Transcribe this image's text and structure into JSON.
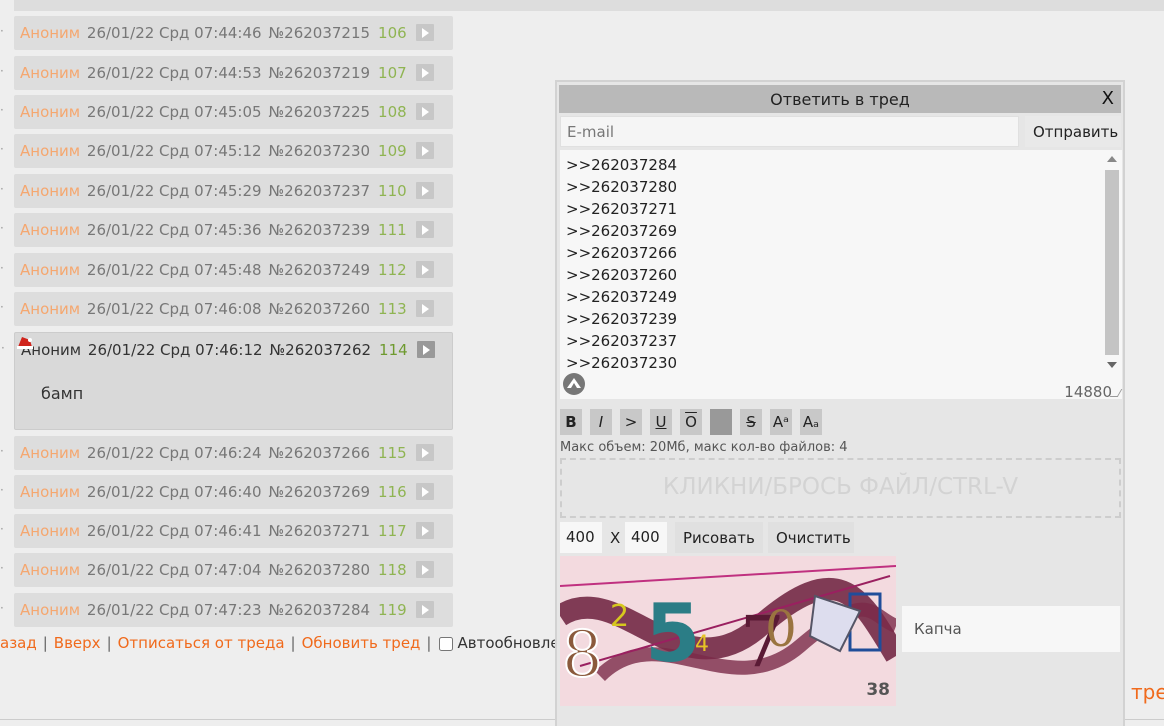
{
  "posts": [
    {
      "name": "Аноним",
      "date": "26/01/22 Срд 07:44:46",
      "num": "№262037215",
      "count": "106"
    },
    {
      "name": "Аноним",
      "date": "26/01/22 Срд 07:44:53",
      "num": "№262037219",
      "count": "107"
    },
    {
      "name": "Аноним",
      "date": "26/01/22 Срд 07:45:05",
      "num": "№262037225",
      "count": "108"
    },
    {
      "name": "Аноним",
      "date": "26/01/22 Срд 07:45:12",
      "num": "№262037230",
      "count": "109"
    },
    {
      "name": "Аноним",
      "date": "26/01/22 Срд 07:45:29",
      "num": "№262037237",
      "count": "110"
    },
    {
      "name": "Аноним",
      "date": "26/01/22 Срд 07:45:36",
      "num": "№262037239",
      "count": "111"
    },
    {
      "name": "Аноним",
      "date": "26/01/22 Срд 07:45:48",
      "num": "№262037249",
      "count": "112"
    },
    {
      "name": "Аноним",
      "date": "26/01/22 Срд 07:46:08",
      "num": "№262037260",
      "count": "113"
    },
    {
      "name": "Аноним",
      "date": "26/01/22 Срд 07:46:12",
      "num": "№262037262",
      "count": "114",
      "body": "бамп"
    },
    {
      "name": "Аноним",
      "date": "26/01/22 Срд 07:46:24",
      "num": "№262037266",
      "count": "115"
    },
    {
      "name": "Аноним",
      "date": "26/01/22 Срд 07:46:40",
      "num": "№262037269",
      "count": "116"
    },
    {
      "name": "Аноним",
      "date": "26/01/22 Срд 07:46:41",
      "num": "№262037271",
      "count": "117"
    },
    {
      "name": "Аноним",
      "date": "26/01/22 Срд 07:47:04",
      "num": "№262037280",
      "count": "118"
    },
    {
      "name": "Аноним",
      "date": "26/01/22 Срд 07:47:23",
      "num": "№262037284",
      "count": "119"
    }
  ],
  "nav": {
    "back": "азад",
    "up": "Вверх",
    "unsubscribe": "Отписаться от треда",
    "refresh": "Обновить тред",
    "autoupdate": "Автообновле",
    "sep": "|",
    "tail": "тре"
  },
  "reply": {
    "title": "Ответить в тред",
    "close": "X",
    "email_placeholder": "E-mail",
    "send": "Отправить",
    "text_lines": [
      ">>262037284",
      ">>262037280",
      ">>262037271",
      ">>262037269",
      ">>262037266",
      ">>262037260",
      ">>262037249",
      ">>262037239",
      ">>262037237",
      ">>262037230"
    ],
    "char_count": "14880",
    "format_buttons": [
      "B",
      "I",
      ">",
      "U",
      "O",
      "",
      "S",
      "Aᵃ",
      "Aₐ"
    ],
    "limit": "Макс объем: 20Мб, макс кол-во файлов: 4",
    "dropzone": "КЛИКНИ/БРОСЬ ФАЙЛ/CTRL-V",
    "width": "400",
    "x_label": "X",
    "height": "400",
    "draw": "Рисовать",
    "clear": "Очистить",
    "captcha_number": "38",
    "captcha_placeholder": "Капча"
  },
  "colors": {
    "accent": "#f06a1c",
    "name": "#f5a76f",
    "count": "#8fb452"
  }
}
